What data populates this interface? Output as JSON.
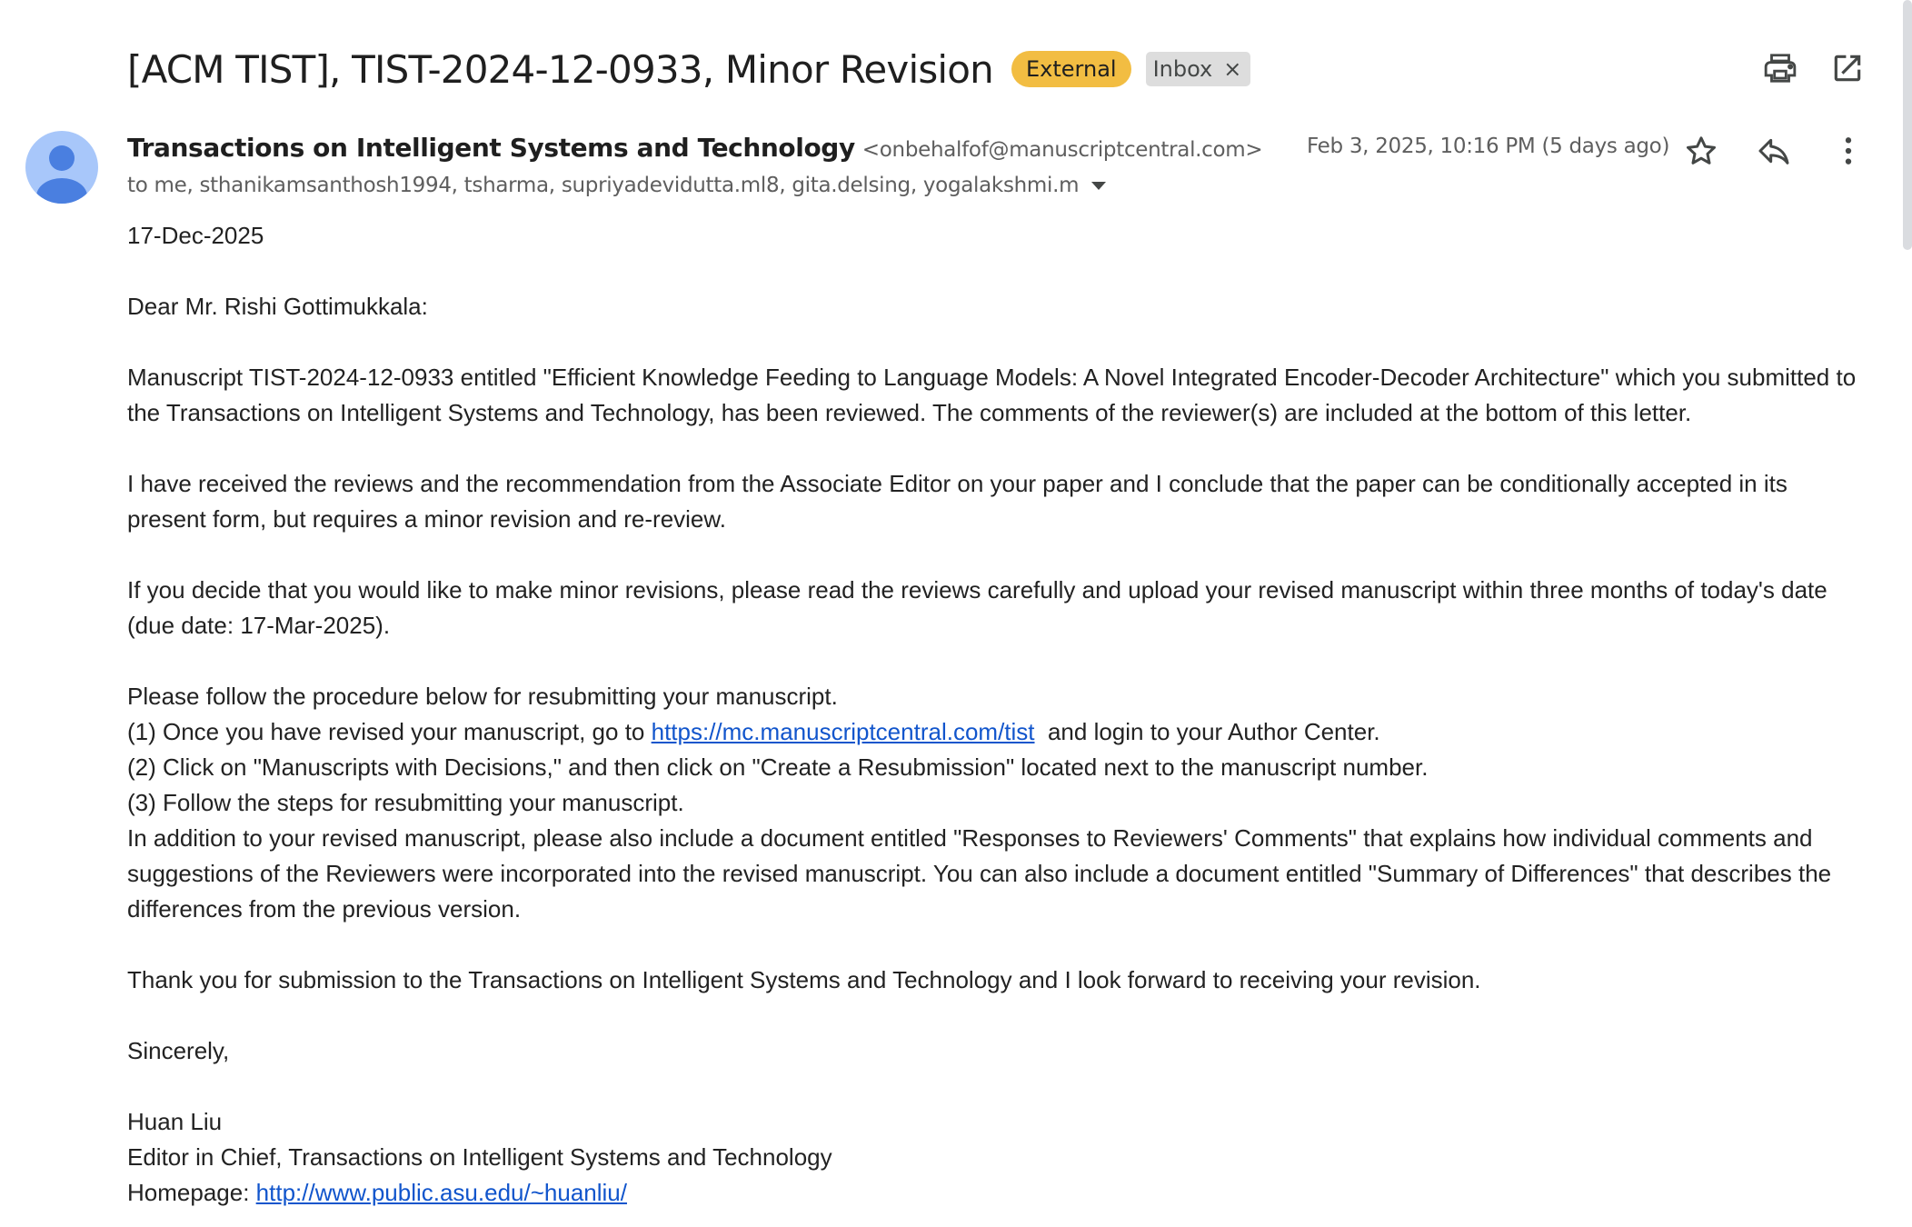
{
  "header": {
    "subject": "[ACM TIST], TIST-2024-12-0933, Minor Revision",
    "labels": {
      "external": "External",
      "inbox": "Inbox",
      "inbox_remove": "×"
    },
    "icons": {
      "print": "print-icon",
      "open_new_window": "open-in-new-window-icon"
    }
  },
  "message": {
    "sender_name": "Transactions on Intelligent Systems and Technology",
    "sender_email": "<onbehalfof@manuscriptcentral.com>",
    "recipients": "to me, sthanikamsanthosh1994, tsharma, supriyadevidutta.ml8, gita.delsing, yogalakshmi.m",
    "date": "Feb 3, 2025, 10:16 PM (5 days ago)",
    "actions": {
      "star": "star-icon",
      "reply": "reply-icon",
      "more": "more-vertical-icon"
    }
  },
  "body": {
    "date_line": "17-Dec-2025",
    "greeting": "Dear Mr. Rishi Gottimukkala:",
    "para1": "Manuscript TIST-2024-12-0933 entitled \"Efficient Knowledge Feeding to Language Models: A Novel Integrated Encoder-Decoder Architecture\" which you submitted to the Transactions on Intelligent Systems and Technology, has been reviewed.  The comments of the reviewer(s) are included at the bottom of this letter.",
    "para2": "I have received the reviews and the recommendation from the Associate Editor on your paper and I conclude that the paper can be conditionally accepted in its present form, but requires a minor revision and re-review.",
    "para3": "If you decide that you would like to make minor revisions, please read the reviews carefully and upload your revised manuscript within three months of today's date (due date: 17-Mar-2025).",
    "procedure_intro": "Please follow the procedure below for resubmitting your manuscript.",
    "step1_prefix": "(1) Once you have revised your manuscript, go to ",
    "step1_link": "https://mc.manuscriptcentral.com/tist",
    "step1_suffix": "  and login to your Author Center.",
    "step2": "(2) Click on \"Manuscripts with Decisions,\" and then click on \"Create a Resubmission\" located next to the manuscript number.",
    "step3": "(3) Follow the steps for resubmitting your manuscript.",
    "para4": "In addition to your revised manuscript, please also include a document entitled \"Responses to Reviewers' Comments\" that explains how individual comments and suggestions of the Reviewers were incorporated into the revised manuscript.  You can also include a document entitled \"Summary of Differences\" that describes the differences from the previous version.",
    "thanks": "Thank you for submission to the Transactions on Intelligent Systems and Technology and I look forward to receiving your revision.",
    "closing": "Sincerely,",
    "signature_name": "Huan Liu",
    "signature_title": "Editor in Chief, Transactions on Intelligent Systems and Technology",
    "homepage_label": "Homepage: ",
    "homepage_link": "http://www.public.asu.edu/~huanliu/"
  },
  "colors": {
    "external_badge": "#f2bd42",
    "inbox_badge": "#dddddd",
    "avatar": "#a8c7fa",
    "link": "#1155cc"
  }
}
